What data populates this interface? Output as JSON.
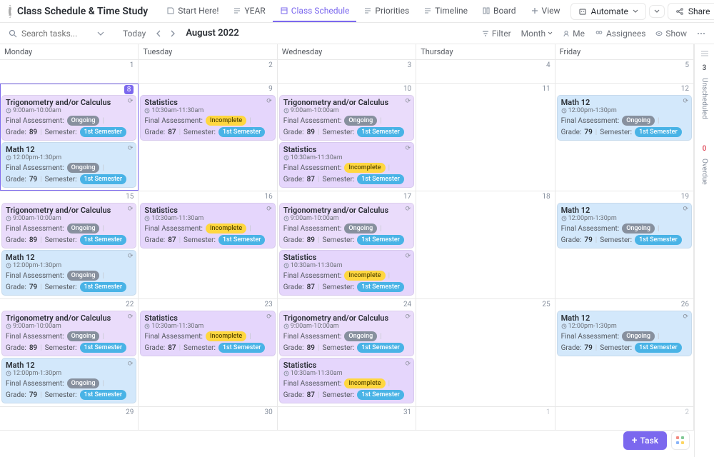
{
  "header": {
    "title": "Class Schedule & Time Study",
    "tabs": [
      {
        "label": "Start Here!"
      },
      {
        "label": "YEAR"
      },
      {
        "label": "Class Schedule",
        "active": true
      },
      {
        "label": "Priorities"
      },
      {
        "label": "Timeline"
      },
      {
        "label": "Board"
      },
      {
        "label": "View"
      }
    ],
    "automate": "Automate",
    "share": "Share"
  },
  "filterbar": {
    "search_placeholder": "Search tasks...",
    "today": "Today",
    "month_label": "August 2022",
    "filter": "Filter",
    "view_mode": "Month",
    "me": "Me",
    "assignees": "Assignees",
    "show": "Show"
  },
  "days": [
    "Monday",
    "Tuesday",
    "Wednesday",
    "Thursday",
    "Friday"
  ],
  "sidebar": {
    "unscheduled_label": "Unscheduled",
    "unscheduled_count": "3",
    "overdue_label": "Overdue",
    "overdue_count": "0"
  },
  "fab": {
    "task": "Task"
  },
  "card_labels": {
    "final_assessment": "Final Assessment:",
    "grade": "Grade:",
    "semester": "Semester:"
  },
  "badges": {
    "ongoing": "Ongoing",
    "incomplete": "Incomplete",
    "sem1": "1st Semester"
  },
  "weeks": [
    {
      "nums": [
        "1",
        "2",
        "3",
        "4",
        "5"
      ],
      "cells": [
        [],
        [],
        [],
        [],
        []
      ],
      "compact": true
    },
    {
      "nums": [
        "8",
        "9",
        "10",
        "11",
        "12"
      ],
      "selected": 0,
      "cells": [
        [
          {
            "title": "Trigonometry and/or Calculus",
            "time": "9:00am-10:00am",
            "status": "ongoing",
            "grade": "89",
            "color": "pur"
          },
          {
            "title": "Math 12",
            "time": "12:00pm-1:30pm",
            "status": "ongoing",
            "grade": "79",
            "color": "blue"
          }
        ],
        [
          {
            "title": "Statistics",
            "time": "10:30am-11:30am",
            "status": "incomplete",
            "grade": "87",
            "color": "viol"
          }
        ],
        [
          {
            "title": "Trigonometry and/or Calculus",
            "time": "9:00am-10:00am",
            "status": "ongoing",
            "grade": "89",
            "color": "pur"
          },
          {
            "title": "Statistics",
            "time": "10:30am-11:30am",
            "status": "incomplete",
            "grade": "87",
            "color": "viol"
          }
        ],
        [],
        [
          {
            "title": "Math 12",
            "time": "12:00pm-1:30pm",
            "status": "ongoing",
            "grade": "79",
            "color": "blue"
          }
        ]
      ]
    },
    {
      "nums": [
        "15",
        "16",
        "17",
        "18",
        "19"
      ],
      "cells": [
        [
          {
            "title": "Trigonometry and/or Calculus",
            "time": "9:00am-10:00am",
            "status": "ongoing",
            "grade": "89",
            "color": "pur"
          },
          {
            "title": "Math 12",
            "time": "12:00pm-1:30pm",
            "status": "ongoing",
            "grade": "79",
            "color": "blue"
          }
        ],
        [
          {
            "title": "Statistics",
            "time": "10:30am-11:30am",
            "status": "incomplete",
            "grade": "87",
            "color": "viol"
          }
        ],
        [
          {
            "title": "Trigonometry and/or Calculus",
            "time": "9:00am-10:00am",
            "status": "ongoing",
            "grade": "89",
            "color": "pur"
          },
          {
            "title": "Statistics",
            "time": "10:30am-11:30am",
            "status": "incomplete",
            "grade": "87",
            "color": "viol"
          }
        ],
        [],
        [
          {
            "title": "Math 12",
            "time": "12:00pm-1:30pm",
            "status": "ongoing",
            "grade": "79",
            "color": "blue"
          }
        ]
      ]
    },
    {
      "nums": [
        "22",
        "23",
        "24",
        "25",
        "26"
      ],
      "cells": [
        [
          {
            "title": "Trigonometry and/or Calculus",
            "time": "9:00am-10:00am",
            "status": "ongoing",
            "grade": "89",
            "color": "pur"
          },
          {
            "title": "Math 12",
            "time": "12:00pm-1:30pm",
            "status": "ongoing",
            "grade": "79",
            "color": "blue"
          }
        ],
        [
          {
            "title": "Statistics",
            "time": "10:30am-11:30am",
            "status": "incomplete",
            "grade": "87",
            "color": "viol"
          }
        ],
        [
          {
            "title": "Trigonometry and/or Calculus",
            "time": "9:00am-10:00am",
            "status": "ongoing",
            "grade": "89",
            "color": "pur"
          },
          {
            "title": "Statistics",
            "time": "10:30am-11:30am",
            "status": "incomplete",
            "grade": "87",
            "color": "viol"
          }
        ],
        [],
        [
          {
            "title": "Math 12",
            "time": "12:00pm-1:30pm",
            "status": "ongoing",
            "grade": "79",
            "color": "blue"
          }
        ]
      ]
    },
    {
      "nums": [
        "29",
        "30",
        "31",
        "1",
        "2"
      ],
      "other_month_cols": [
        3,
        4
      ],
      "compact": true,
      "cells": [
        [],
        [],
        [],
        [],
        []
      ]
    }
  ]
}
